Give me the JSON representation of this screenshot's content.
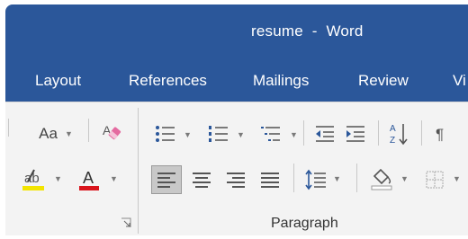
{
  "window": {
    "title": "resume  -  Word"
  },
  "tabs": [
    {
      "label": "Layout"
    },
    {
      "label": "References"
    },
    {
      "label": "Mailings"
    },
    {
      "label": "Review"
    },
    {
      "label": "Vi"
    }
  ],
  "font_group": {
    "change_case_label": "Aa",
    "font_color_glyph": "A",
    "highlight_color": "#f2e400",
    "font_color": "#d9141c"
  },
  "paragraph_group": {
    "label": "Paragraph",
    "sort_label": "A Z"
  },
  "colors": {
    "title_bar": "#2b579a",
    "ribbon_bg": "#f3f3f3",
    "icon_blue": "#2b579a",
    "selected_bg": "#c8c8c8"
  }
}
